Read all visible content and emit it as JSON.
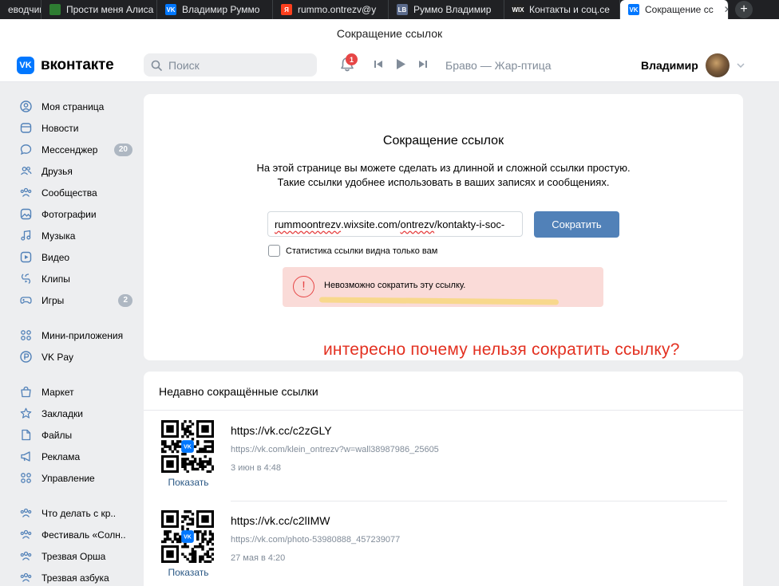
{
  "browser": {
    "tabs": [
      {
        "label": "еводчик",
        "fav": "",
        "color": "#202124"
      },
      {
        "label": "Прости меня Алиса",
        "fav": "",
        "color": "#2e7d32"
      },
      {
        "label": "Владимир Руммо",
        "fav": "VK",
        "color": "#0077ff"
      },
      {
        "label": "rummo.ontrezv@y",
        "fav": "Я",
        "color": "#fc3f1d"
      },
      {
        "label": "Руммо Владимир",
        "fav": "LB",
        "color": "#5b6b8c"
      },
      {
        "label": "Контакты и соц.се",
        "fav": "WIX",
        "color": "#222"
      },
      {
        "label": "Сокращение сс",
        "fav": "VK",
        "color": "#0077ff",
        "active": true
      }
    ],
    "new_tab_label": "+",
    "close_glyph": "✕"
  },
  "window_title": "Сокращение ссылок",
  "header": {
    "logo_mark": "VK",
    "logo_text": "вконтакте",
    "search_placeholder": "Поиск",
    "notifications_count": "1",
    "track": "Браво — Жар-птица",
    "user_name": "Владимир"
  },
  "sidebar": {
    "items": [
      {
        "label": "Моя страница",
        "icon": "user-circle-icon"
      },
      {
        "label": "Новости",
        "icon": "news-icon"
      },
      {
        "label": "Мессенджер",
        "icon": "message-icon",
        "badge": "20"
      },
      {
        "label": "Друзья",
        "icon": "friends-icon"
      },
      {
        "label": "Сообщества",
        "icon": "communities-icon"
      },
      {
        "label": "Фотографии",
        "icon": "photo-icon"
      },
      {
        "label": "Музыка",
        "icon": "music-icon"
      },
      {
        "label": "Видео",
        "icon": "video-icon"
      },
      {
        "label": "Клипы",
        "icon": "clips-icon"
      },
      {
        "label": "Игры",
        "icon": "gamepad-icon",
        "badge": "2"
      },
      {
        "label": "Мини-приложения",
        "icon": "apps-icon",
        "group": 1
      },
      {
        "label": "VK Pay",
        "icon": "vkpay-icon",
        "group": 1
      },
      {
        "label": "Маркет",
        "icon": "market-icon",
        "group": 2
      },
      {
        "label": "Закладки",
        "icon": "star-icon",
        "group": 2
      },
      {
        "label": "Файлы",
        "icon": "file-icon",
        "group": 2
      },
      {
        "label": "Реклама",
        "icon": "megaphone-icon",
        "group": 2
      },
      {
        "label": "Управление",
        "icon": "apps-icon",
        "group": 2
      },
      {
        "label": "Что делать с кр..",
        "icon": "communities-icon",
        "group": 3
      },
      {
        "label": "Фестиваль «Солн..",
        "icon": "communities-icon",
        "group": 3
      },
      {
        "label": "Трезвая Орша",
        "icon": "communities-icon",
        "group": 3
      },
      {
        "label": "Трезвая азбука",
        "icon": "communities-icon",
        "group": 3
      }
    ]
  },
  "main": {
    "title": "Сокращение ссылок",
    "description_line1": "На этой странице вы можете сделать из длинной и сложной ссылки простую.",
    "description_line2": "Такие ссылки удобнее использовать в ваших записях и сообщениях.",
    "input_value": {
      "seg1": "rummoontrezv",
      "seg2": ".wixsite.com/",
      "seg3": "ontrezv",
      "seg4": "/kontakty-i-soc-"
    },
    "shorten_label": "Сократить",
    "stats_label": "Статистика ссылки видна только вам",
    "error_glyph": "!",
    "error_text": "Невозможно сократить эту ссылку.",
    "annotation": "интересно почему нельзя сократить ссылку?"
  },
  "recent": {
    "title": "Недавно сокращённые ссылки",
    "items": [
      {
        "short": "https://vk.cc/c2zGLY",
        "long": "https://vk.com/klein_ontrezv?w=wall38987986_25605",
        "date": "3 июн в 4:48",
        "show_label": "Показать"
      },
      {
        "short": "https://vk.cc/c2lIMW",
        "long": "https://vk.com/photo-53980888_457239077",
        "date": "27 мая в 4:20",
        "show_label": "Показать"
      }
    ]
  },
  "colors": {
    "accent": "#5181b8",
    "vk_blue": "#0077ff",
    "error_bg": "#fadbd8",
    "error_red": "#e64646",
    "annotation_red": "#e33020",
    "highlight": "#f7d77f"
  }
}
